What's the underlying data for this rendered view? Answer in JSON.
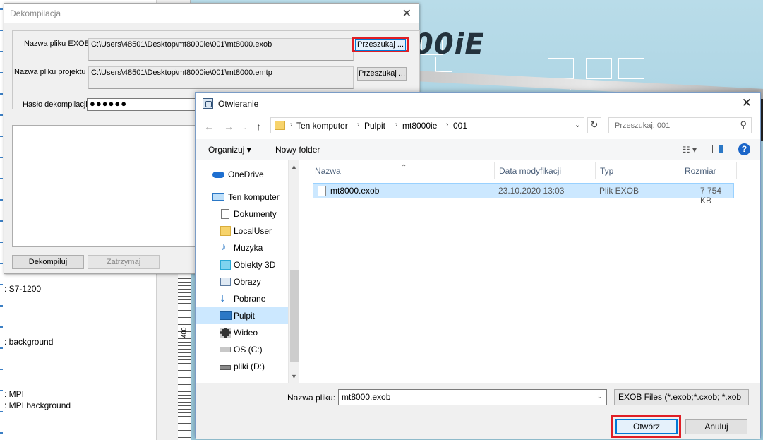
{
  "background_app": {
    "lines": [
      ": S7-1200",
      ": background",
      ": MPI",
      ": MPI background"
    ],
    "logo": "00iE",
    "ruler_label": "400"
  },
  "decompile_dialog": {
    "title": "Dekompilacja",
    "close_glyph": "✕",
    "exob_label": "Nazwa pliku EXOB",
    "exob_path": "C:\\Users\\48501\\Desktop\\mt8000ie\\001\\mt8000.exob",
    "project_label": "Nazwa pliku projektu",
    "project_path": "C:\\Users\\48501\\Desktop\\mt8000ie\\001\\mt8000.emtp",
    "browse_label": "Przeszukaj ...",
    "password_label": "Hasło dekompilacji",
    "password_value": "●●●●●●",
    "decompile_button": "Dekompiluj",
    "stop_button": "Zatrzymaj"
  },
  "open_dialog": {
    "title": "Otwieranie",
    "close_glyph": "✕",
    "breadcrumb": [
      "Ten komputer",
      "Pulpit",
      "mt8000ie",
      "001"
    ],
    "search_placeholder": "Przeszukaj: 001",
    "toolbar": {
      "organize": "Organizuj ▾",
      "new_folder": "Nowy folder",
      "help": "?"
    },
    "nav_items": [
      {
        "label": "OneDrive",
        "icon": "cloud-icon"
      },
      {
        "label": "Ten komputer",
        "icon": "computer-icon"
      },
      {
        "label": "Dokumenty",
        "icon": "document-icon"
      },
      {
        "label": "LocalUser",
        "icon": "folder-icon"
      },
      {
        "label": "Muzyka",
        "icon": "music-icon"
      },
      {
        "label": "Obiekty 3D",
        "icon": "cube-icon"
      },
      {
        "label": "Obrazy",
        "icon": "picture-icon"
      },
      {
        "label": "Pobrane",
        "icon": "download-icon"
      },
      {
        "label": "Pulpit",
        "icon": "desktop-icon"
      },
      {
        "label": "Wideo",
        "icon": "video-icon"
      },
      {
        "label": "OS (C:)",
        "icon": "drive-icon"
      },
      {
        "label": "pliki (D:)",
        "icon": "drive-icon"
      }
    ],
    "columns": [
      "Nazwa",
      "Data modyfikacji",
      "Typ",
      "Rozmiar"
    ],
    "files": [
      {
        "name": "mt8000.exob",
        "modified": "23.10.2020 13:03",
        "type": "Plik EXOB",
        "size": "7 754 KB"
      }
    ],
    "filename_label": "Nazwa pliku:",
    "filename_value": "mt8000.exob",
    "filter_value": "EXOB Files (*.exob;*.cxob; *.xob",
    "open_button": "Otwórz",
    "cancel_button": "Anuluj"
  },
  "colors": {
    "highlight": "#e01e25",
    "selection": "#cce8ff",
    "accent": "#0078d7"
  }
}
